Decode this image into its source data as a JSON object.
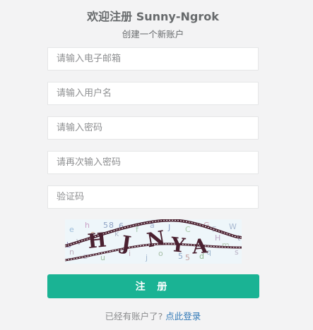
{
  "header": {
    "title": "欢迎注册 Sunny-Ngrok",
    "subtitle": "创建一个新账户"
  },
  "form": {
    "email_placeholder": "请输入电子邮箱",
    "username_placeholder": "请输入用户名",
    "password_placeholder": "请输入密码",
    "confirm_password_placeholder": "请再次输入密码",
    "captcha_placeholder": "验证码",
    "captcha_text": "HJNYA",
    "submit_label": "注 册"
  },
  "footer": {
    "prompt": "已经有账户了?",
    "login_link": "点此登录"
  },
  "colors": {
    "background": "#f3f3f4",
    "primary_button": "#1ab394",
    "link": "#337ab7"
  }
}
